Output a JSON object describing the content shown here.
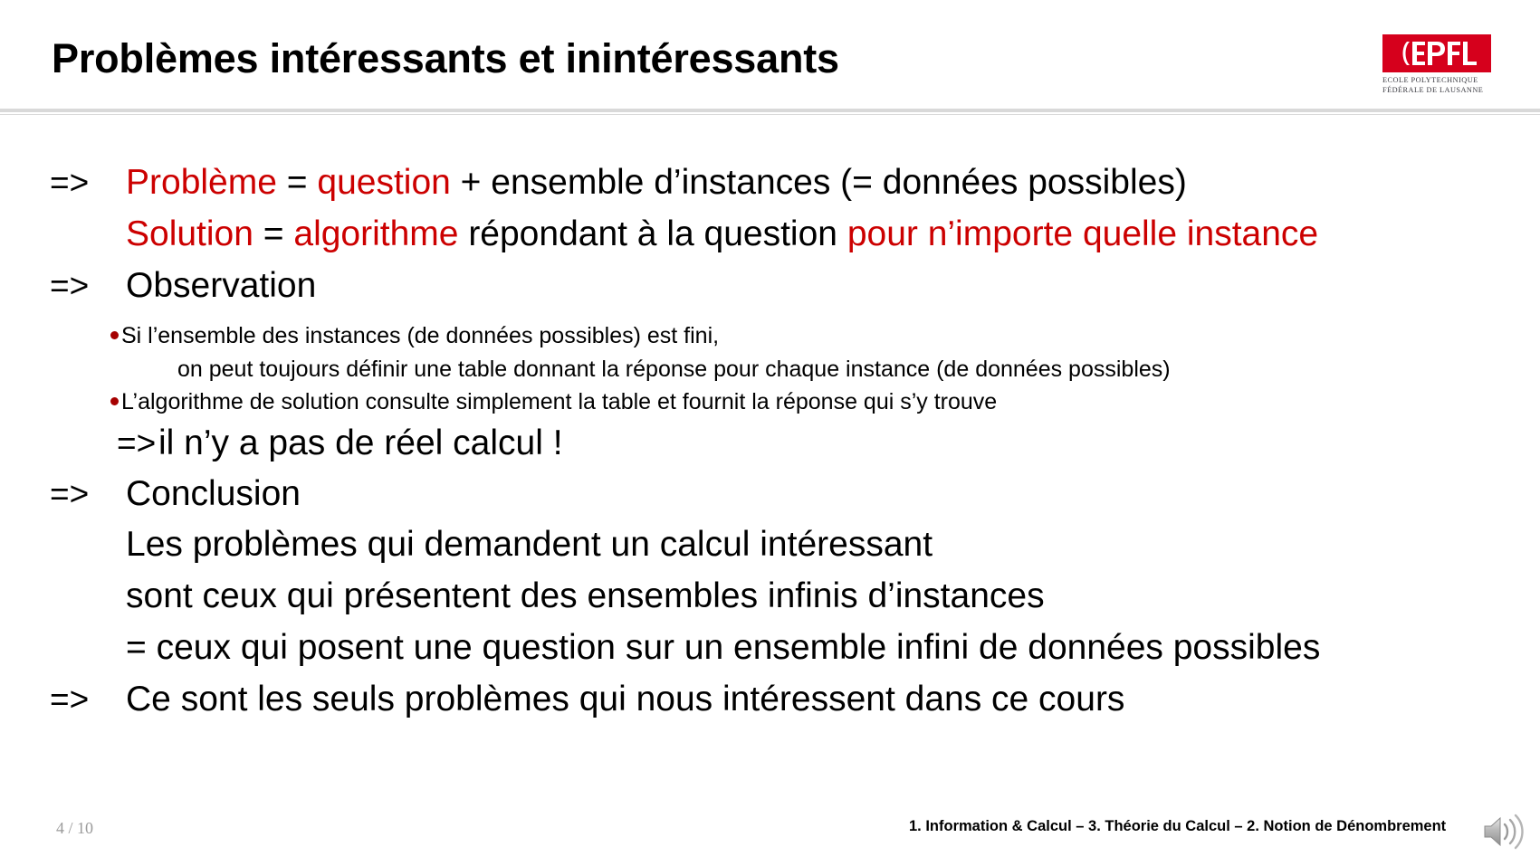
{
  "slide": {
    "title": "Problèmes intéressants et inintéressants",
    "accent_red": "#cc0000",
    "bullet_red": "#a60000",
    "logo_red": "#d6001c",
    "rule_gray": "#d9d9d9",
    "page_number_gray": "#9b9b9b"
  },
  "logo": {
    "wordmark": "EPFL",
    "line1": "ECOLE POLYTECHNIQUE",
    "line2": "FÉDÉRALE DE LAUSANNE"
  },
  "content": {
    "arrow": "=>",
    "line1": {
      "seg1_red": "Problème",
      "seg2_black": " = ",
      "seg3_red": "question",
      "seg4_black": " + ensemble d’instances (= données possibles)"
    },
    "line2": {
      "seg1_red": "Solution",
      "seg2_black": " = ",
      "seg3_red": "algorithme",
      "seg4_black": " répondant à la question ",
      "seg5_red": "pour n’importe quelle instance"
    },
    "observation": "Observation",
    "bullet1": "Si l’ensemble des instances (de données possibles) est fini,",
    "bullet1_cont": "on peut toujours définir une table donnant la réponse pour chaque instance (de données possibles)",
    "bullet2": "L’algorithme de solution consulte simplement la table et fournit la réponse qui s’y trouve",
    "no_real_calc": "il n’y a pas de réel calcul !",
    "conclusion": "Conclusion",
    "concl_line1": "Les problèmes qui demandent un calcul intéressant",
    "concl_line2": "sont ceux qui présentent des ensembles infinis d’instances",
    "concl_line3": "= ceux qui posent une question sur un ensemble infini de données possibles",
    "final_line": "Ce sont les seuls problèmes qui nous intéressent dans ce cours"
  },
  "footer": {
    "page": "4 / 10",
    "caption": "1. Information & Calcul – 3. Théorie du Calcul – 2. Notion de Dénombrement",
    "audio_icon": "speaker-icon"
  }
}
